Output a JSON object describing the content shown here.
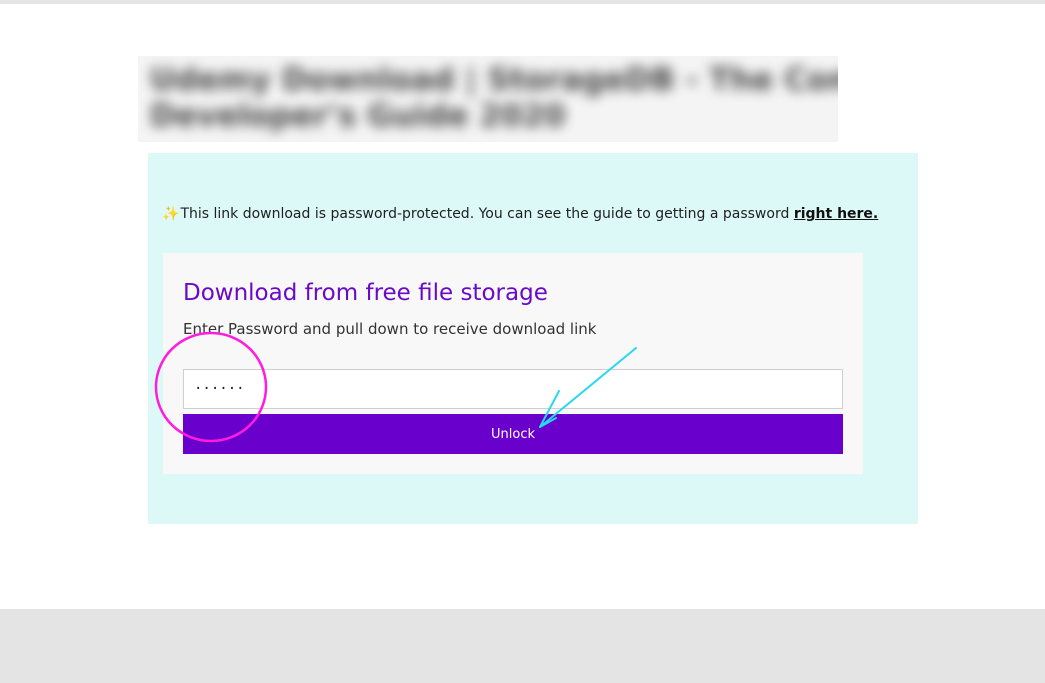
{
  "header": {
    "blurred_title_line1": "Udemy Download | StorageDB - The Complete",
    "blurred_title_line2": "Developer's Guide 2020"
  },
  "notice": {
    "icon": "sparkle-icon",
    "text": "This link download is password-protected. You can see the guide to getting a password ",
    "link_label": "right here."
  },
  "card": {
    "title": "Download from free file storage",
    "subtitle": "Enter Password and pull down to receive download link",
    "password_value": "······",
    "unlock_label": "Unlock"
  },
  "colors": {
    "accent": "#6a00cc",
    "title_purple": "#6a0ac9",
    "notice_bg": "#dcf9f8",
    "card_bg": "#f8f8f8",
    "annotation_circle": "#ff1ce0",
    "annotation_arrow": "#27d8f2",
    "footer_bg": "#e4e4e4"
  }
}
